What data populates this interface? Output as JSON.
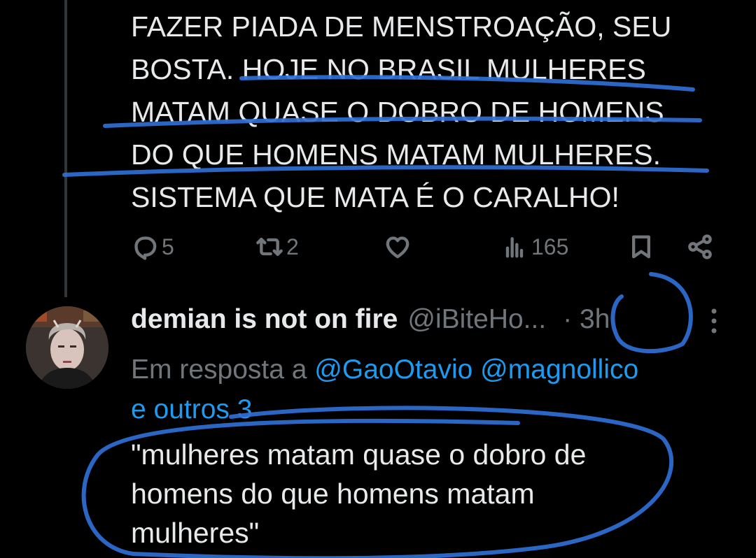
{
  "original_tweet": {
    "text_lines": [
      "FAZER PIADA DE MENSTROAÇÃO, SEU",
      "BOSTA. HOJE NO BRASIL MULHERES",
      "MATAM QUASE O DOBRO DE HOMENS",
      "DO QUE HOMENS MATAM MULHERES.",
      "SISTEMA QUE MATA É O CARALHO!"
    ],
    "actions": {
      "replies": "5",
      "reposts": "2",
      "likes": "",
      "views": "165"
    }
  },
  "reply_tweet": {
    "display_name": "demian is not on fire",
    "handle": "@iBiteHo...",
    "time": "· 3h",
    "replying_to_prefix": "Em resposta a",
    "mentions": [
      "@GaoOtavio",
      "@magnollico"
    ],
    "others": "e outros 3",
    "text_lines": [
      "\"mulheres matam quase o dobro de",
      "homens do que homens matam",
      "mulheres\""
    ]
  },
  "colors": {
    "background": "#000000",
    "text": "#e7e9ea",
    "muted": "#71767b",
    "link": "#1d9bf0",
    "annotation": "#2f6fd6"
  },
  "icons": [
    "reply-icon",
    "repost-icon",
    "like-icon",
    "views-icon",
    "bookmark-icon",
    "share-icon",
    "more-icon"
  ]
}
